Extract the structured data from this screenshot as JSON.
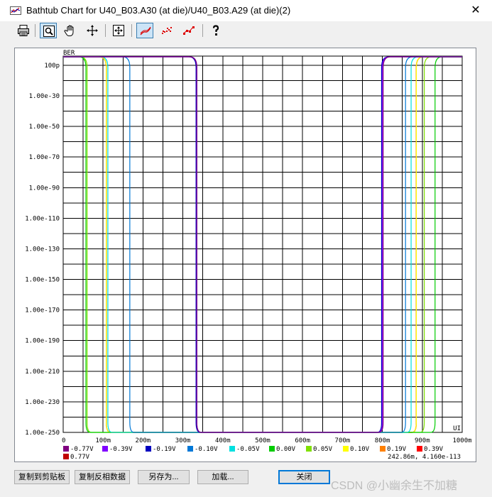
{
  "window": {
    "title": "Bathtub Chart for U40_B03.A30 (at die)/U40_B03.A29 (at die)(2)",
    "close_glyph": "✕"
  },
  "toolbar": {
    "buttons": [
      {
        "name": "print-icon",
        "active": false
      },
      {
        "name": "zoom-icon",
        "active": true
      },
      {
        "name": "pan-hand-icon",
        "active": false
      },
      {
        "name": "crosshair-icon",
        "active": false
      },
      {
        "name": "fit-view-icon",
        "active": false
      },
      {
        "name": "line-plot-icon",
        "active": true
      },
      {
        "name": "dot-plot-icon",
        "active": false
      },
      {
        "name": "line-dot-plot-icon",
        "active": false
      },
      {
        "name": "help-icon",
        "active": false
      }
    ]
  },
  "chart_data": {
    "type": "line",
    "title": "",
    "xlabel": "UI",
    "ylabel": "BER",
    "xlim": [
      0,
      1000
    ],
    "y_log_exponent_range": [
      -250,
      -4
    ],
    "grid": true,
    "x_ticks": [
      {
        "value": 0,
        "label": "0"
      },
      {
        "value": 100,
        "label": "100m"
      },
      {
        "value": 200,
        "label": "200m"
      },
      {
        "value": 300,
        "label": "300m"
      },
      {
        "value": 400,
        "label": "400m"
      },
      {
        "value": 500,
        "label": "500m"
      },
      {
        "value": 600,
        "label": "600m"
      },
      {
        "value": 700,
        "label": "700m"
      },
      {
        "value": 800,
        "label": "800m"
      },
      {
        "value": 900,
        "label": "900m"
      },
      {
        "value": 1000,
        "label": "1000m"
      }
    ],
    "y_ticks": [
      {
        "exp": -10,
        "label": "100p"
      },
      {
        "exp": -30,
        "label": "1.00e-30"
      },
      {
        "exp": -50,
        "label": "1.00e-50"
      },
      {
        "exp": -70,
        "label": "1.00e-70"
      },
      {
        "exp": -90,
        "label": "1.00e-90"
      },
      {
        "exp": -110,
        "label": "1.00e-110"
      },
      {
        "exp": -130,
        "label": "1.00e-130"
      },
      {
        "exp": -150,
        "label": "1.00e-150"
      },
      {
        "exp": -170,
        "label": "1.00e-170"
      },
      {
        "exp": -190,
        "label": "1.00e-190"
      },
      {
        "exp": -210,
        "label": "1.00e-210"
      },
      {
        "exp": -230,
        "label": "1.00e-230"
      },
      {
        "exp": -250,
        "label": "1.00e-250"
      }
    ],
    "series": [
      {
        "name": "-0.77V",
        "color": "#800080",
        "left_edge": 335,
        "right_edge": 802
      },
      {
        "name": "-0.39V",
        "color": "#8000ff",
        "left_edge": 335,
        "right_edge": 800
      },
      {
        "name": "-0.19V",
        "color": "#0000c0",
        "left_edge": 333,
        "right_edge": 798
      },
      {
        "name": "-0.10V",
        "color": "#0078d7",
        "left_edge": 167,
        "right_edge": 858
      },
      {
        "name": "-0.05V",
        "color": "#00e0e0",
        "left_edge": 112,
        "right_edge": 872
      },
      {
        "name": "0.00V",
        "color": "#00cc00",
        "left_edge": 57,
        "right_edge": 932
      },
      {
        "name": "0.05V",
        "color": "#80e000",
        "left_edge": 60,
        "right_edge": 905
      },
      {
        "name": "0.10V",
        "color": "#ffff00",
        "left_edge": 108,
        "right_edge": 885
      },
      {
        "name": "0.19V",
        "color": "#ff8000",
        "left_edge": 108,
        "right_edge": 885
      },
      {
        "name": "0.39V",
        "color": "#ff0000",
        "left_edge": 108,
        "right_edge": 885
      },
      {
        "name": "0.77V",
        "color": "#c00000",
        "left_edge": 108,
        "right_edge": 885
      }
    ],
    "cursor_readout": "242.86m, 4.160e-113"
  },
  "buttons": {
    "copy_clipboard": "复制到剪贴板",
    "copy_inverse": "复制反相数据",
    "save_as": "另存为...",
    "load": "加载...",
    "close": "关闭"
  },
  "watermark": "CSDN @小幽余生不加糖"
}
